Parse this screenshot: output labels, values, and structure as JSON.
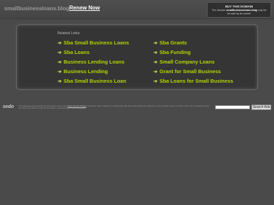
{
  "header": {
    "domain": "smallbusinessloans.blog",
    "renew_label": "Renew Now",
    "buy_box": {
      "title": "BUY THIS DOMAIN",
      "text_prefix": "The domain ",
      "domain": "smallbusinessloans.blog",
      "text_suffix": " may be for sale by its owner!"
    }
  },
  "related": {
    "heading": "Related Links",
    "left_links": [
      "Sba Small Business Loans",
      "Sba Loans",
      "Business Lending Loans",
      "Business Lending",
      "Sba Small Business Loan"
    ],
    "right_links": [
      "Sba Grants",
      "Sba Funding",
      "Small Company Loans",
      "Grant for Small Business",
      "Sba Loans for Small Business"
    ],
    "arrow_icon": "arrow-right-icon",
    "link_color": "#b6d400"
  },
  "footer": {
    "logo": "sedo",
    "disclaimer_prefix": "This webpage was generated by the domain owner using ",
    "disclaimer_link": "Sedo Domain Parking",
    "disclaimer_suffix": ". Disclaimer: Sedo maintains no relationship with third party advertisers. Reference to any specific service or trade mark is not controlled by Sedo nor does it constitute or imply its association, endorsement or recommendation.",
    "search_placeholder": "",
    "search_button": "Search Ads"
  }
}
